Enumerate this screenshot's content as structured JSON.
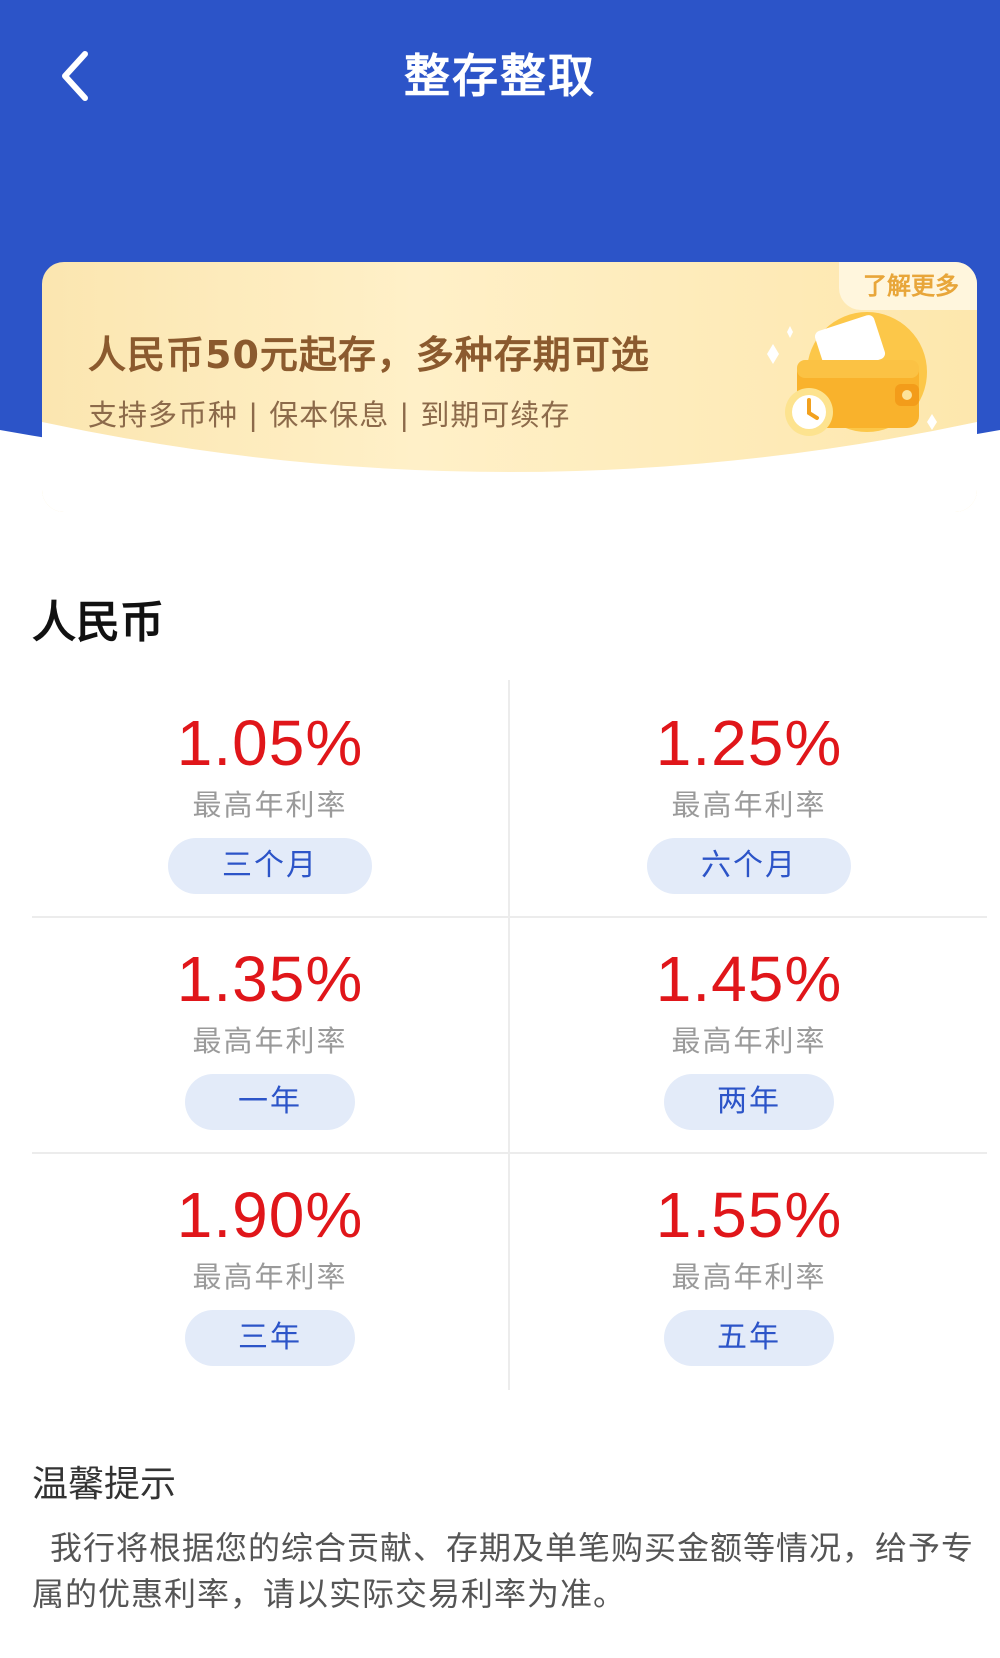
{
  "header": {
    "title": "整存整取",
    "back_icon": "chevron-left-icon",
    "color": "#2c54c8"
  },
  "banner": {
    "title": "人民币50元起存，多种存期可选",
    "subtitle": "支持多币种 | 保本保息 | 到期可续存",
    "learn_more": "了解更多",
    "illustration_icon": "wallet-clock-icon"
  },
  "section": {
    "title": "人民币"
  },
  "products": [
    {
      "rate": "1.05%",
      "label": "最高年利率",
      "term": "三个月"
    },
    {
      "rate": "1.25%",
      "label": "最高年利率",
      "term": "六个月"
    },
    {
      "rate": "1.35%",
      "label": "最高年利率",
      "term": "一年"
    },
    {
      "rate": "1.45%",
      "label": "最高年利率",
      "term": "两年"
    },
    {
      "rate": "1.90%",
      "label": "最高年利率",
      "term": "三年"
    },
    {
      "rate": "1.55%",
      "label": "最高年利率",
      "term": "五年"
    }
  ],
  "tips": {
    "title": "温馨提示",
    "text": "我行将根据您的综合贡献、存期及单笔购买金额等情况，给予专属的优惠利率，请以实际交易利率为准。"
  },
  "colors": {
    "rate": "#e0161a",
    "term_bg": "#e3ebf9",
    "term_text": "#2c54c8"
  }
}
